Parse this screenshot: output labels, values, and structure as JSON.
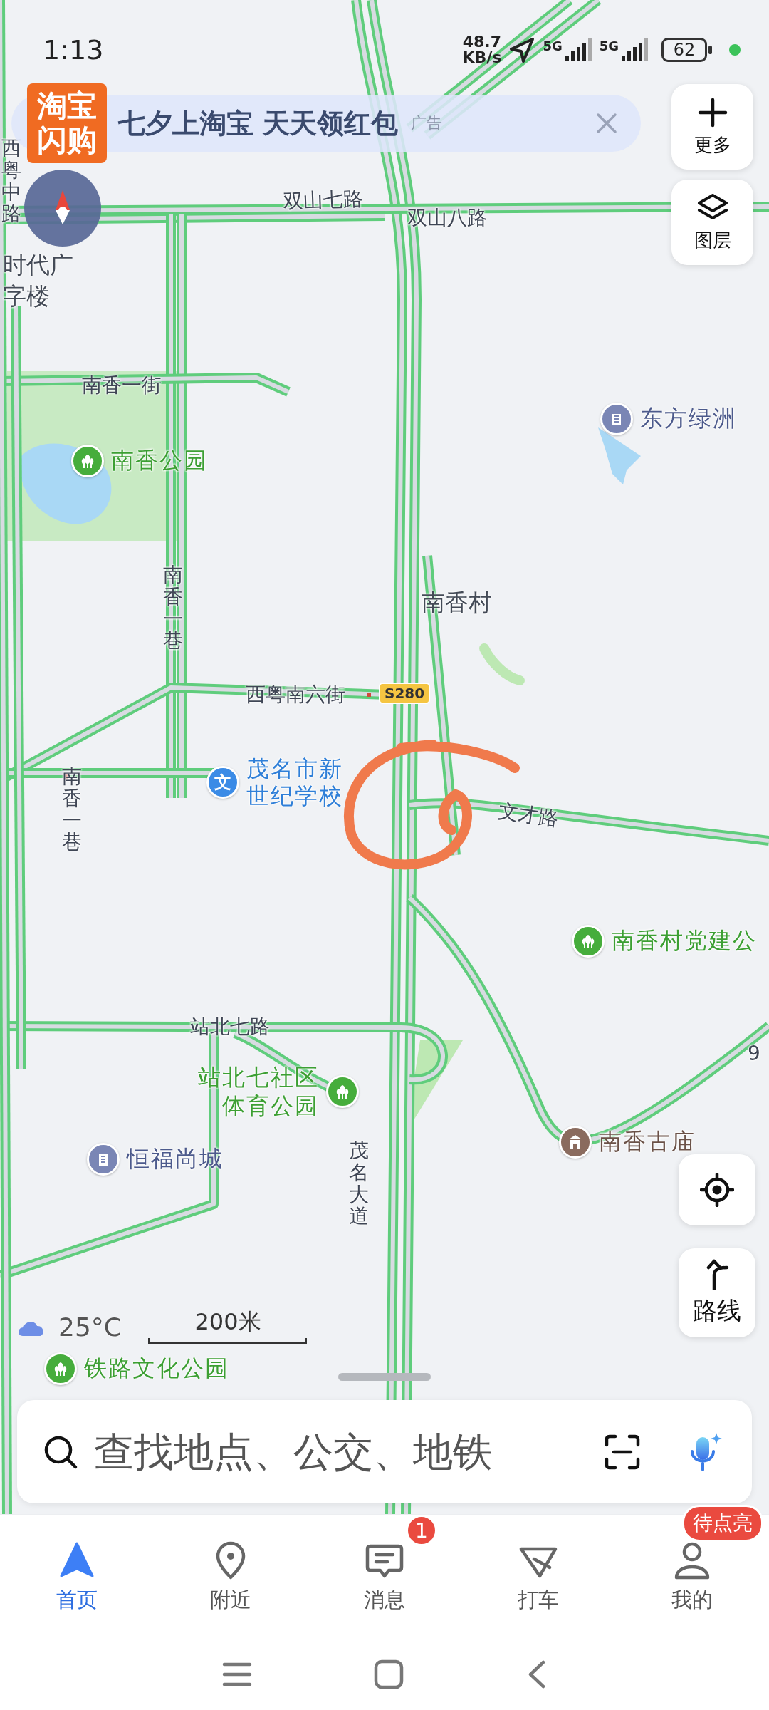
{
  "status_bar": {
    "time": "1:13",
    "net_speed_value": "48.7",
    "net_speed_unit": "KB/s",
    "sim_1": "5G",
    "sim_2": "5G",
    "battery": "62"
  },
  "ad_banner": {
    "logo_lines": [
      "淘宝",
      "闪购"
    ],
    "text": "七夕上淘宝 天天领红包",
    "tag": "广告"
  },
  "map_buttons": [
    {
      "label": "更多",
      "kind": "more"
    },
    {
      "label": "图层",
      "kind": "layers"
    }
  ],
  "map": {
    "labels": [
      {
        "text": "双山七路",
        "kind": "road"
      },
      {
        "text": "双山八路",
        "kind": "road"
      },
      {
        "text": "西粤中路",
        "kind": "road_vertical"
      },
      {
        "text": "时代广",
        "kind": "area"
      },
      {
        "text": "字楼",
        "kind": "area"
      },
      {
        "text": "南香一街",
        "kind": "road"
      },
      {
        "text": "南香村",
        "kind": "area"
      },
      {
        "text": "南香一巷",
        "kind": "road_vertical"
      },
      {
        "text": "西粤南六街",
        "kind": "road"
      },
      {
        "text": "南香一巷",
        "kind": "road_vertical"
      },
      {
        "text": "文才路",
        "kind": "road"
      },
      {
        "text": "站北七路",
        "kind": "road"
      },
      {
        "text": "9",
        "kind": "road"
      },
      {
        "text": "茂名大道",
        "kind": "road_vertical"
      }
    ],
    "road_shield": "S280",
    "pois": [
      {
        "name": "南香公园",
        "kind": "park"
      },
      {
        "name": "东方绿洲",
        "kind": "residential"
      },
      {
        "name": "茂名市新世纪学校",
        "kind": "school",
        "pin_text": "文"
      },
      {
        "name": "南香村党建公",
        "kind": "park"
      },
      {
        "name": "站北七社区体育公园",
        "kind": "park"
      },
      {
        "name": "恒福尚城",
        "kind": "residential"
      },
      {
        "name": "南香古庙",
        "kind": "temple"
      },
      {
        "name": "铁路文化公园",
        "kind": "park"
      }
    ],
    "weather": "25°C",
    "scale": "200米"
  },
  "route_button": {
    "label": "路线"
  },
  "search": {
    "placeholder": "查找地点、公交、地铁"
  },
  "tabs": [
    {
      "label": "首页",
      "kind": "home",
      "selected": true
    },
    {
      "label": "附近",
      "kind": "nearby",
      "selected": false
    },
    {
      "label": "消息",
      "kind": "messages",
      "selected": false,
      "badge": "1"
    },
    {
      "label": "打车",
      "kind": "taxi",
      "selected": false
    },
    {
      "label": "我的",
      "kind": "me",
      "selected": false,
      "badge": "待点亮"
    }
  ]
}
